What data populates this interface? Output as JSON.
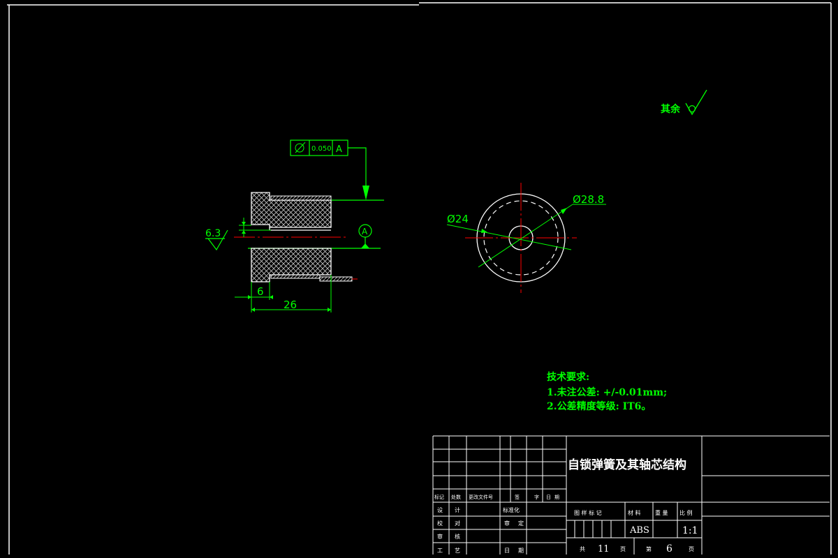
{
  "colors": {
    "background": "#000000",
    "frame": "#ffffff",
    "outline": "#ffffff",
    "dimension": "#00ff00",
    "centerline": "#ff0000",
    "hatch": "#c8c8c8",
    "text_green": "#00ff00"
  },
  "roughness": {
    "label": "其余"
  },
  "left_view": {
    "tolerance_value": "0.050",
    "datum_letter": "A",
    "roughness_value": "6.3",
    "dim_small": "6",
    "dim_length": "26",
    "datum_marker": "A"
  },
  "right_view": {
    "dim_outer": "Ø28.8",
    "dim_inner": "Ø24"
  },
  "tech_requirements": {
    "title": "技术要求:",
    "line1": "1.未注公差: +/-0.01mm;",
    "line2": "2.公差精度等级: IT6。"
  },
  "title_block": {
    "part_name": "自锁弹簧及其轴芯结构",
    "header_labels": [
      "标记",
      "处数",
      "更改文件号",
      "签",
      "字",
      "日",
      "期"
    ],
    "row_design": "设",
    "row_design2": "计",
    "row_standard": "标准化",
    "row_check": "校",
    "row_check2": "对",
    "row_review": "审",
    "row_review2": "定",
    "row_audit": "审",
    "row_audit2": "核",
    "row_craft": "工",
    "row_craft2": "艺",
    "row_date": "日",
    "row_date2": "期",
    "stage_label": "图 样 标 记",
    "material_label": "材 料",
    "weight_label": "重 量",
    "scale_label": "比 例",
    "material": "ABS",
    "scale": "1:1",
    "total_label": "共",
    "total_sheets": "11",
    "sheet_unit": "页",
    "sheet_label": "第",
    "sheet_number": "6",
    "sheet_unit2": "页"
  }
}
